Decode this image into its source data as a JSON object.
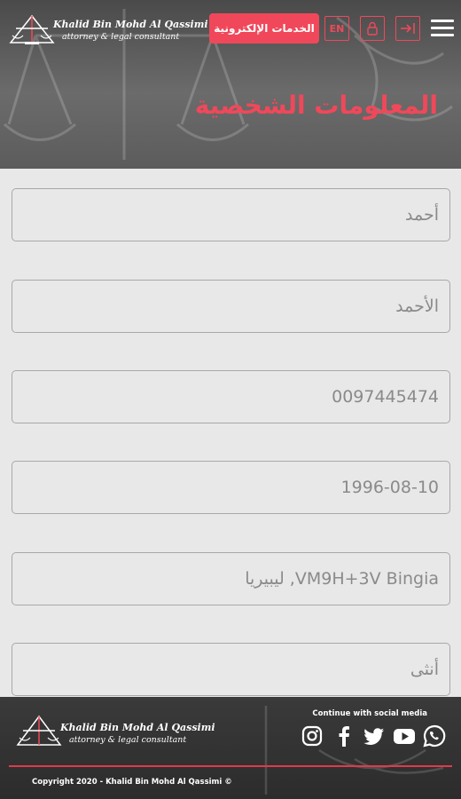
{
  "header": {
    "logo": {
      "name": "Khalid Bin Mohd Al Qassimi",
      "subtitle": "attorney & legal consultant"
    },
    "eservices_label": "الخدمات الإلكترونية",
    "lang_label": "EN",
    "icons": [
      "lock-icon",
      "login-icon",
      "hamburger-menu-icon"
    ],
    "accent_color": "#f0485a"
  },
  "page": {
    "title": "المعلومات الشخصية"
  },
  "form": {
    "fields": [
      {
        "value": "أحمد"
      },
      {
        "value": "الأحمد"
      },
      {
        "value": "0097445474"
      },
      {
        "value": "1996-08-10"
      },
      {
        "value": "VM9H+3V Bingia, ليبيريا"
      },
      {
        "value": "أنثى"
      }
    ]
  },
  "footer": {
    "logo": {
      "name": "Khalid Bin Mohd Al Qassimi",
      "subtitle": "attorney & legal consultant"
    },
    "social_label": "Continue with social media",
    "social_icons": [
      "instagram-icon",
      "facebook-icon",
      "twitter-icon",
      "youtube-icon",
      "whatsapp-icon"
    ],
    "copyright": "Copyright 2020 - Khalid Bin Mohd Al Qassimi ©"
  }
}
